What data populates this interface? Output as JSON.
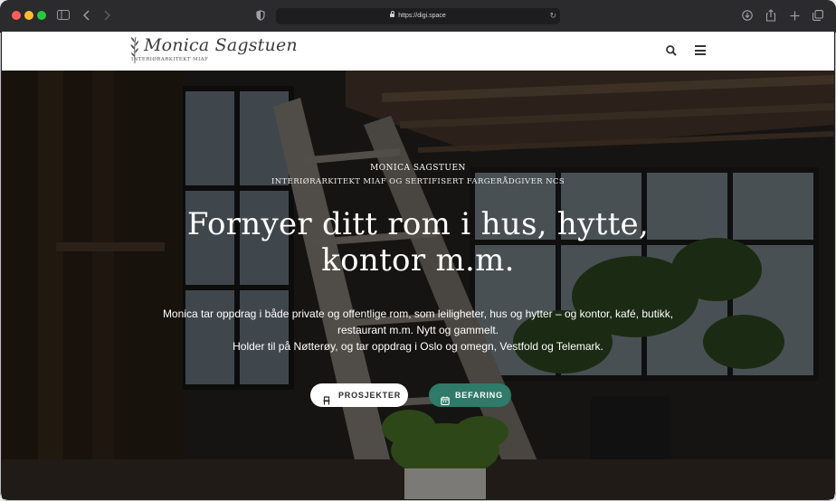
{
  "browser": {
    "url": "https://digi.space",
    "icons": {
      "sidebar": "sidebar-icon",
      "back": "chevron-left-icon",
      "forward": "chevron-right-icon",
      "privacy": "shield-icon",
      "reload": "reload-icon",
      "downloads": "download-icon",
      "share": "share-icon",
      "new_tab": "plus-icon",
      "tabs": "tabs-overview-icon"
    }
  },
  "site": {
    "logo_name": "Monica Sagstuen",
    "logo_tagline": "INTERIØRARKITEKT MIAF",
    "header_icons": {
      "search": "search-icon",
      "menu": "menu-icon"
    }
  },
  "hero": {
    "name": "MONICA SAGSTUEN",
    "subtitle": "INTERIØRARKITEKT MIAF OG SERTIFISERT FARGERÅDGIVER NCS",
    "title": "Fornyer ditt rom i hus, hytte, kontor m.m.",
    "description_line1": "Monica tar oppdrag i både private og offentlige rom, som leiligheter, hus og hytter – og kontor, kafé, butikk, restaurant m.m. Nytt og gammelt.",
    "description_line2": "Holder til på Nøtterøy, og tar oppdrag i Oslo og omegn, Vestfold og Telemark.",
    "buttons": {
      "projects_label": "PROSJEKTER",
      "projects_icon": "chair-icon",
      "booking_label": "BEFARING",
      "booking_icon": "calendar-icon"
    }
  },
  "colors": {
    "accent_green": "#2f7a68",
    "header_bg": "#ffffff",
    "chrome_bg": "#2b2b2d"
  }
}
